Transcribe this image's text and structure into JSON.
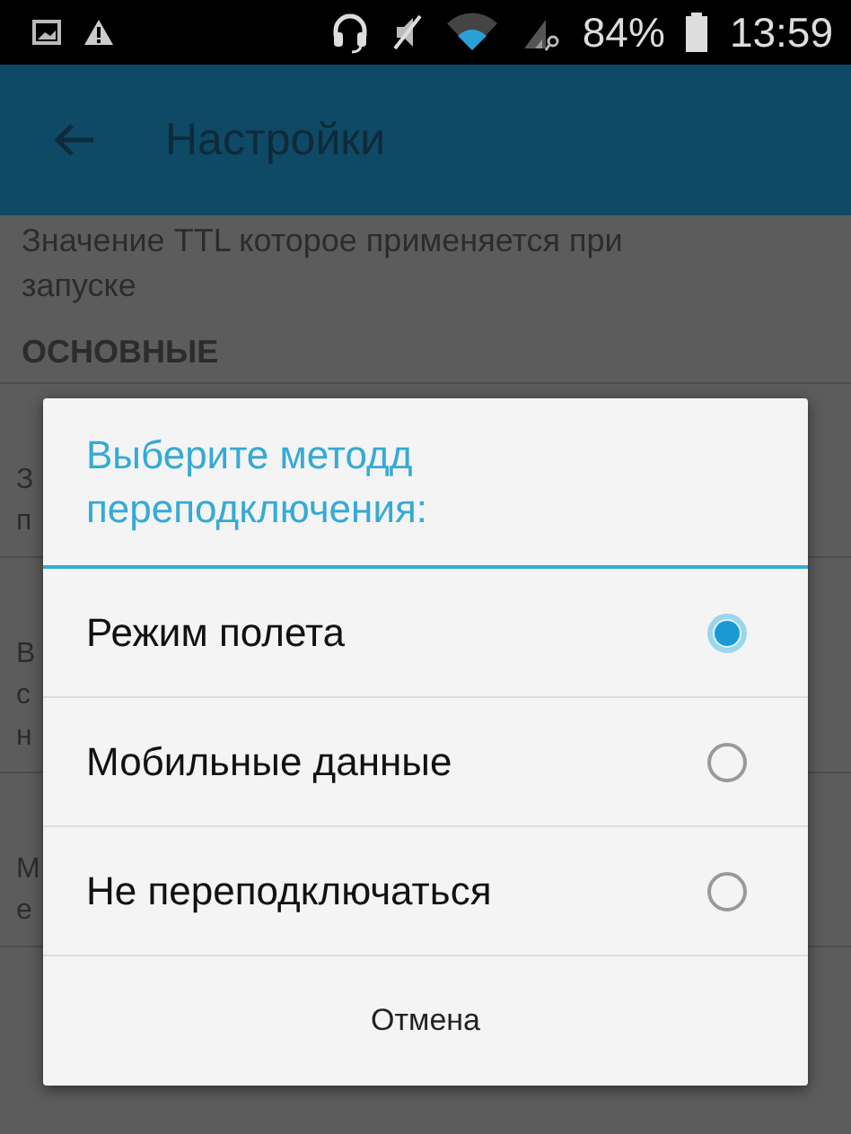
{
  "status_bar": {
    "battery": "84%",
    "time": "13:59"
  },
  "app_bar": {
    "title": "Настройки"
  },
  "settings": {
    "intro": [
      "Значение TTL которое применяется при",
      "запуске"
    ],
    "section": "ОСНОВНЫЕ",
    "items": [
      {
        "summary": [
          "З",
          "п"
        ]
      },
      {
        "summary": [
          "В",
          "с",
          "н"
        ]
      },
      {
        "summary": [
          "М",
          "е"
        ]
      }
    ]
  },
  "dialog": {
    "title": "Выберите методд переподключения:",
    "options": [
      {
        "label": "Режим полета",
        "selected": true
      },
      {
        "label": "Мобильные данные",
        "selected": false
      },
      {
        "label": "Не переподключаться",
        "selected": false
      }
    ],
    "buttons": [
      "Отмена"
    ]
  }
}
